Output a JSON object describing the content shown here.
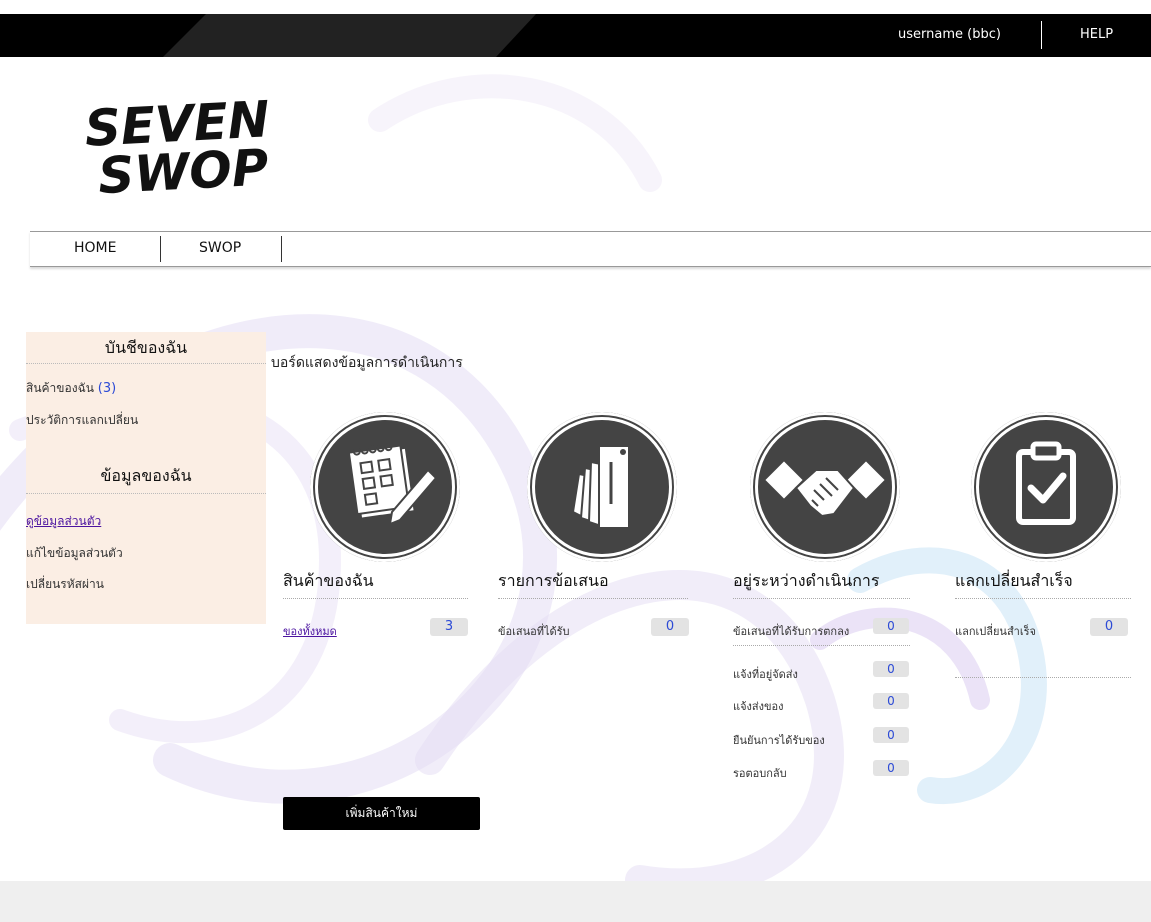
{
  "header": {
    "username": "username (bbc)",
    "help": "HELP"
  },
  "logo": {
    "line1": "SEVEN",
    "line2": "SWOP"
  },
  "nav": {
    "items": [
      {
        "label": "HOME"
      },
      {
        "label": "SWOP"
      }
    ]
  },
  "sidebar": {
    "section1_title": "บันชีของฉัน",
    "my_items_label": "สินค้าของฉัน",
    "my_items_count": "(3)",
    "history_label": "ประวัติการแลกเปลี่ยน",
    "section2_title": "ข้อมูลของฉัน",
    "view_profile": "ดูข้อมูลส่วนตัว",
    "edit_profile": "แก้ไขข้อมูลส่วนตัว",
    "change_password": "เปลี่ยนรหัสผ่าน"
  },
  "dashboard": {
    "title": "บอร์ดแสดงข้อมูลการดำเนินการ",
    "cards": [
      {
        "title": "สินค้าของฉัน",
        "icon": "notepad-icon",
        "rows": [
          {
            "label": "ของทั้งหมด",
            "value": "3"
          }
        ]
      },
      {
        "title": "รายการข้อเสนอ",
        "icon": "cards-icon",
        "rows": [
          {
            "label": "ข้อเสนอที่ได้รับ",
            "value": "0"
          }
        ]
      },
      {
        "title": "อยู่ระหว่างดำเนินการ",
        "icon": "handshake-icon",
        "rows": [
          {
            "label": "ข้อเสนอที่ได้รับการตกลง",
            "value": "0"
          },
          {
            "label": "แจ้งที่อยู่จัดส่ง",
            "value": "0"
          },
          {
            "label": "แจ้งส่งของ",
            "value": "0"
          },
          {
            "label": "ยืนยันการได้รับของ",
            "value": "0"
          },
          {
            "label": "รอตอบกลับ",
            "value": "0"
          }
        ]
      },
      {
        "title": "แลกเปลี่ยนสำเร็จ",
        "icon": "clipboard-check-icon",
        "rows": [
          {
            "label": "แลกเปลี่ยนสำเร็จ",
            "value": "0"
          }
        ]
      }
    ],
    "add_button": "เพิ่มสินค้าใหม่"
  },
  "colors": {
    "accent": "#2c4ad6",
    "link": "#4b14a0",
    "sidebar_bg": "#fbeee4",
    "topbar": "#000000"
  }
}
